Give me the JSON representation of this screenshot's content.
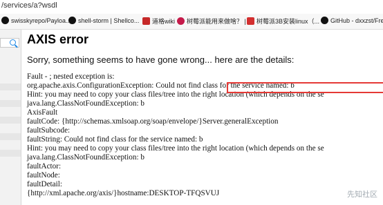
{
  "url": "/services/a?wsdl",
  "bookmarks": [
    {
      "label": "swisskyrepo/Payloa...",
      "icon": "github-icon"
    },
    {
      "label": "shell-storm | Shellco...",
      "icon": "github-icon"
    },
    {
      "label": "道格wiki",
      "icon": "p-icon"
    },
    {
      "label": "树莓派能用来做啥？ | ...",
      "icon": "raspberry-icon"
    },
    {
      "label": "树莓派3B安装linux（...",
      "icon": "c-icon"
    },
    {
      "label": "GitHub - dxxzst/Fre...",
      "icon": "github-icon"
    }
  ],
  "page": {
    "title": "AXIS error",
    "subtitle": "Sorry, something seems to have gone wrong... here are the details:"
  },
  "error_lines": [
    "Fault - ; nested exception is:",
    "        org.apache.axis.ConfigurationException: Could not find class for the service named: b",
    "Hint: you may need to copy your class files/tree into the right location (which depends on the se",
    "        java.lang.ClassNotFoundException: b",
    "AxisFault",
    " faultCode: {http://schemas.xmlsoap.org/soap/envelope/}Server.generalException",
    " faultSubcode:",
    " faultString: Could not find class for the service named: b",
    "Hint: you may need to copy your class files/tree into the right location (which depends on the se",
    "        java.lang.ClassNotFoundException: b",
    " faultActor:",
    " faultNode:",
    " faultDetail:",
    "        {http://xml.apache.org/axis/}hostname:DESKTOP-TFQSVUJ"
  ],
  "watermark": "先知社区"
}
